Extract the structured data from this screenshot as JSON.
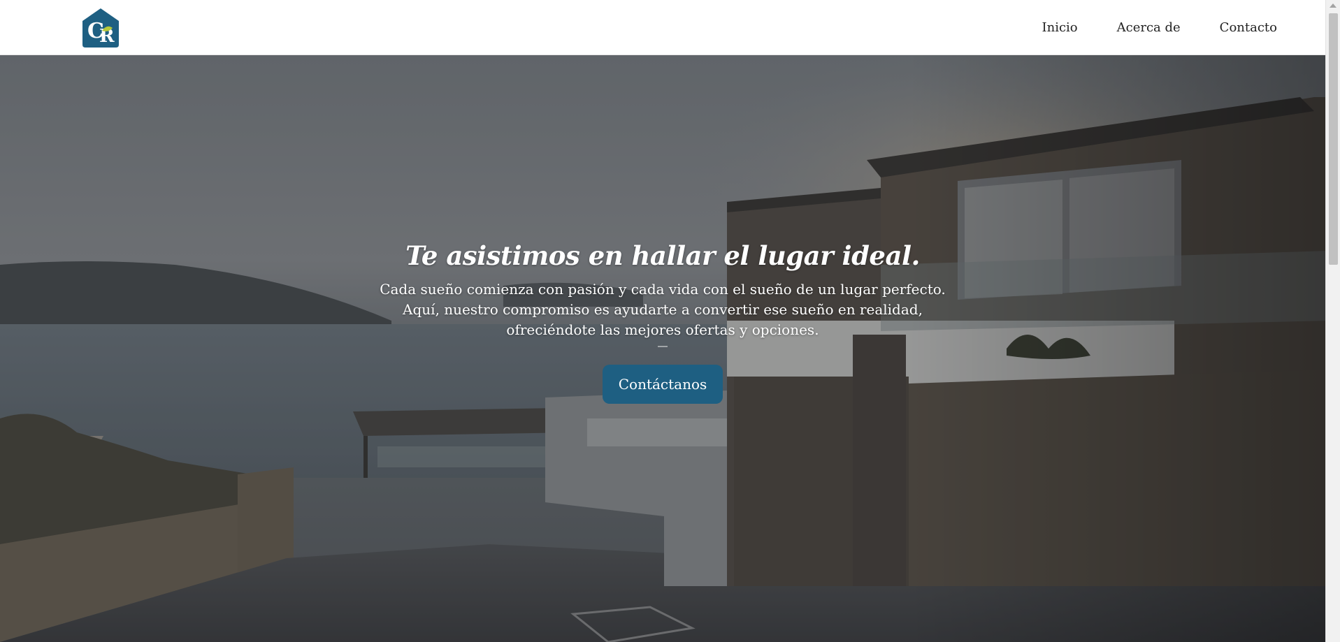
{
  "header": {
    "logo_text": "CR",
    "nav": [
      {
        "label": "Inicio"
      },
      {
        "label": "Acerca de"
      },
      {
        "label": "Contacto"
      }
    ]
  },
  "hero": {
    "title": "Te asistimos en hallar el lugar ideal.",
    "text_lines": [
      "Cada sueño comienza con pasión y cada vida con el sueño de un lugar perfecto.",
      "Aquí, nuestro compromiso es ayudarte a convertir ese sueño en realidad,",
      "ofreciéndote las mejores ofertas y opciones."
    ],
    "cta_label": "Contáctanos"
  },
  "colors": {
    "brand": "#1e5f82",
    "logo_accent": "#b7c93a",
    "header_bg": "#ffffff"
  },
  "icons": {
    "logo": "house-logo-icon",
    "scroll_up": "chevron-up-icon"
  }
}
